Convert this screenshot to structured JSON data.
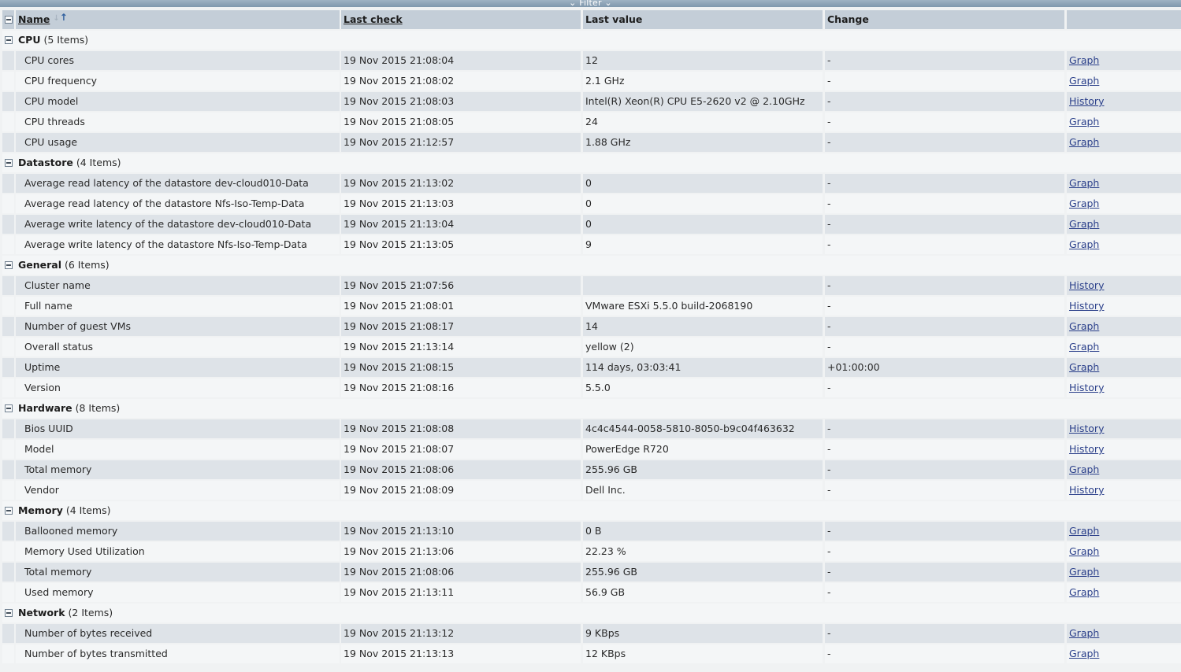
{
  "filter": {
    "label": "Filter"
  },
  "header": {
    "name": "Name",
    "last_check": "Last check",
    "last_value": "Last value",
    "change": "Change"
  },
  "groups": [
    {
      "name": "CPU",
      "count": "(5 Items)",
      "items": [
        {
          "name": "CPU cores",
          "last_check": "19 Nov 2015 21:08:04",
          "value": "12",
          "change": "-",
          "action": "Graph"
        },
        {
          "name": "CPU frequency",
          "last_check": "19 Nov 2015 21:08:02",
          "value": "2.1 GHz",
          "change": "-",
          "action": "Graph"
        },
        {
          "name": "CPU model",
          "last_check": "19 Nov 2015 21:08:03",
          "value": "Intel(R) Xeon(R) CPU E5-2620 v2 @ 2.10GHz",
          "change": "-",
          "action": "History"
        },
        {
          "name": "CPU threads",
          "last_check": "19 Nov 2015 21:08:05",
          "value": "24",
          "change": "-",
          "action": "Graph"
        },
        {
          "name": "CPU usage",
          "last_check": "19 Nov 2015 21:12:57",
          "value": "1.88 GHz",
          "change": "-",
          "action": "Graph"
        }
      ]
    },
    {
      "name": "Datastore",
      "count": "(4 Items)",
      "items": [
        {
          "name": "Average read latency of the datastore dev-cloud010-Data",
          "last_check": "19 Nov 2015 21:13:02",
          "value": "0",
          "change": "-",
          "action": "Graph"
        },
        {
          "name": "Average read latency of the datastore Nfs-Iso-Temp-Data",
          "last_check": "19 Nov 2015 21:13:03",
          "value": "0",
          "change": "-",
          "action": "Graph"
        },
        {
          "name": "Average write latency of the datastore dev-cloud010-Data",
          "last_check": "19 Nov 2015 21:13:04",
          "value": "0",
          "change": "-",
          "action": "Graph"
        },
        {
          "name": "Average write latency of the datastore Nfs-Iso-Temp-Data",
          "last_check": "19 Nov 2015 21:13:05",
          "value": "9",
          "change": "-",
          "action": "Graph"
        }
      ]
    },
    {
      "name": "General",
      "count": "(6 Items)",
      "items": [
        {
          "name": "Cluster name",
          "last_check": "19 Nov 2015 21:07:56",
          "value": "",
          "change": "-",
          "action": "History"
        },
        {
          "name": "Full name",
          "last_check": "19 Nov 2015 21:08:01",
          "value": "VMware ESXi 5.5.0 build-2068190",
          "change": "-",
          "action": "History"
        },
        {
          "name": "Number of guest VMs",
          "last_check": "19 Nov 2015 21:08:17",
          "value": "14",
          "change": "-",
          "action": "Graph"
        },
        {
          "name": "Overall status",
          "last_check": "19 Nov 2015 21:13:14",
          "value": "yellow (2)",
          "change": "-",
          "action": "Graph"
        },
        {
          "name": "Uptime",
          "last_check": "19 Nov 2015 21:08:15",
          "value": "114 days, 03:03:41",
          "change": "+01:00:00",
          "action": "Graph"
        },
        {
          "name": "Version",
          "last_check": "19 Nov 2015 21:08:16",
          "value": "5.5.0",
          "change": "-",
          "action": "History"
        }
      ]
    },
    {
      "name": "Hardware",
      "count": "(8 Items)",
      "items": [
        {
          "name": "Bios UUID",
          "last_check": "19 Nov 2015 21:08:08",
          "value": "4c4c4544-0058-5810-8050-b9c04f463632",
          "change": "-",
          "action": "History"
        },
        {
          "name": "Model",
          "last_check": "19 Nov 2015 21:08:07",
          "value": "PowerEdge R720",
          "change": "-",
          "action": "History"
        },
        {
          "name": "Total memory",
          "last_check": "19 Nov 2015 21:08:06",
          "value": "255.96 GB",
          "change": "-",
          "action": "Graph"
        },
        {
          "name": "Vendor",
          "last_check": "19 Nov 2015 21:08:09",
          "value": "Dell Inc.",
          "change": "-",
          "action": "History"
        }
      ]
    },
    {
      "name": "Memory",
      "count": "(4 Items)",
      "items": [
        {
          "name": "Ballooned memory",
          "last_check": "19 Nov 2015 21:13:10",
          "value": "0 B",
          "change": "-",
          "action": "Graph"
        },
        {
          "name": "Memory Used Utilization",
          "last_check": "19 Nov 2015 21:13:06",
          "value": "22.23 %",
          "change": "-",
          "action": "Graph"
        },
        {
          "name": "Total memory",
          "last_check": "19 Nov 2015 21:08:06",
          "value": "255.96 GB",
          "change": "-",
          "action": "Graph"
        },
        {
          "name": "Used memory",
          "last_check": "19 Nov 2015 21:13:11",
          "value": "56.9 GB",
          "change": "-",
          "action": "Graph"
        }
      ]
    },
    {
      "name": "Network",
      "count": "(2 Items)",
      "items": [
        {
          "name": "Number of bytes received",
          "last_check": "19 Nov 2015 21:13:12",
          "value": "9 KBps",
          "change": "-",
          "action": "Graph"
        },
        {
          "name": "Number of bytes transmitted",
          "last_check": "19 Nov 2015 21:13:13",
          "value": "12 KBps",
          "change": "-",
          "action": "Graph"
        }
      ]
    }
  ]
}
